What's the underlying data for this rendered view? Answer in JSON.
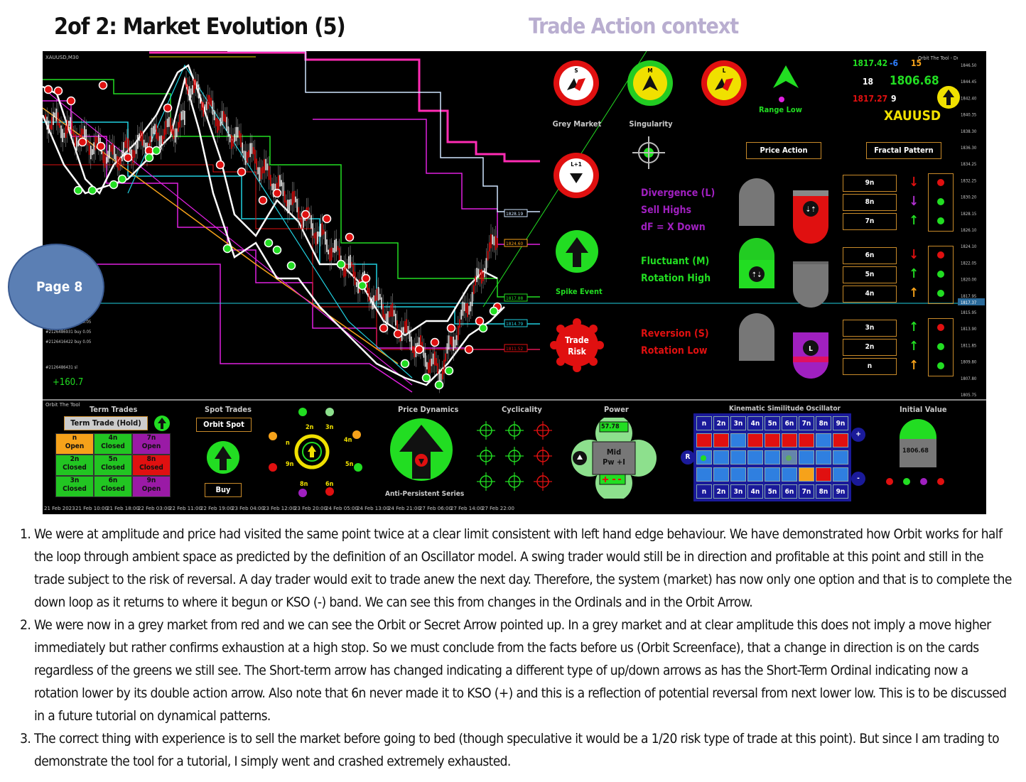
{
  "header": {
    "title": "2of 2: Market Evolution (5)",
    "context": "Trade Action context"
  },
  "page_badge": "Page 8",
  "chart": {
    "symbol_label": "XAUUSD,M30",
    "indicator_name": "Orbit The Tool - Dual",
    "price_ticks": [
      "1846.50",
      "1844.45",
      "1842.40",
      "1840.35",
      "1838.30",
      "1836.30",
      "1834.25",
      "1832.25",
      "1830.20",
      "1828.15",
      "1826.10",
      "1824.10",
      "1822.05",
      "1820.00",
      "1817.95",
      "1815.95",
      "1813.90",
      "1811.85",
      "1809.80",
      "1807.80",
      "1805.75"
    ],
    "current_price": "1817.37",
    "level_tags": [
      "1828.19",
      "1824.60",
      "1817.88",
      "1814.79",
      "1811.52"
    ],
    "orders": [
      "#2126599471 buy 0.05",
      "#2126486931 buy 0.05",
      "#2126416422 buy 0.05",
      "#2126486431 sl"
    ],
    "profit": "+160.7",
    "time_ticks": [
      "21 Feb 2023",
      "21 Feb 10:00",
      "21 Feb 18:00",
      "22 Feb 03:00",
      "22 Feb 11:00",
      "22 Feb 19:00",
      "23 Feb 04:00",
      "23 Feb 12:00",
      "23 Feb 20:00",
      "24 Feb 05:00",
      "24 Feb 13:00",
      "24 Feb 21:00",
      "27 Feb 06:00",
      "27 Feb 14:00",
      "27 Feb 22:00"
    ]
  },
  "context_panel": {
    "circles": [
      {
        "letter": "S",
        "label": "Grey Market"
      },
      {
        "letter": "M",
        "label": "Singularity"
      },
      {
        "letter": "L",
        "label": ""
      }
    ],
    "range_low": "Range Low",
    "quote": {
      "bid": "1817.42",
      "delta": "-6",
      "count": "15",
      "left_num": "18",
      "price": "1806.68",
      "low": "1817.27",
      "right_num": "9",
      "symbol": "XAUUSD"
    },
    "lplus1": "L+1",
    "spike_event": "Spike Event",
    "trade_risk": [
      "Trade",
      "Risk"
    ],
    "price_action_btn": "Price Action",
    "fractal_pattern_btn": "Fractal Pattern",
    "divergence": [
      "Divergence (L)",
      "Sell Highs",
      "dF = X Down"
    ],
    "fluctuant": [
      "Fluctuant (M)",
      "Rotation High"
    ],
    "reversion": [
      "Reversion (S)",
      "Rotation Low"
    ],
    "ordinals": [
      "9n",
      "8n",
      "7n",
      "6n",
      "5n",
      "4n",
      "3n",
      "2n",
      "n"
    ],
    "ordinal_arrows": [
      "down-red",
      "down-purple",
      "up-green",
      "down-red",
      "up-green",
      "up-orange",
      "up-green",
      "up-green",
      "up-orange"
    ],
    "ordinal_dots": [
      "red",
      "green",
      "green",
      "red",
      "green",
      "green",
      "red",
      "green",
      "green"
    ],
    "l_badge": "L"
  },
  "lower_panel": {
    "brand": "Orbit The Tool",
    "term_trades": {
      "title": "Term Trades",
      "button": "Term Trade (Hold)",
      "cells": [
        {
          "top": "n",
          "bottom": "Open",
          "color": "#f6a21a"
        },
        {
          "top": "4n",
          "bottom": "Closed",
          "color": "#22c522"
        },
        {
          "top": "7n",
          "bottom": "Open",
          "color": "#9a1aa6"
        },
        {
          "top": "2n",
          "bottom": "Closed",
          "color": "#22c522"
        },
        {
          "top": "5n",
          "bottom": "Closed",
          "color": "#22c522"
        },
        {
          "top": "8n",
          "bottom": "Closed",
          "color": "#e01010"
        },
        {
          "top": "3n",
          "bottom": "Closed",
          "color": "#22c522"
        },
        {
          "top": "6n",
          "bottom": "Closed",
          "color": "#22c522"
        },
        {
          "top": "9n",
          "bottom": "Open",
          "color": "#9a1aa6"
        }
      ]
    },
    "spot_trades": {
      "title": "Spot Trades",
      "button": "Orbit Spot",
      "buy": "Buy"
    },
    "ring_labels": [
      "2n",
      "3n",
      "4n",
      "5n",
      "6n",
      "8n",
      "9n",
      "n"
    ],
    "price_dynamics": {
      "title": "Price Dynamics",
      "caption": "Anti-Persistent Series"
    },
    "cyclicality": {
      "title": "Cyclicality"
    },
    "power": {
      "title": "Power",
      "value": "57.78",
      "line1": "Mid",
      "line2": "Pw +I"
    },
    "kso": {
      "title": "Kinematic Similitude Oscillator",
      "header": [
        "n",
        "2n",
        "3n",
        "4n",
        "5n",
        "6n",
        "7n",
        "8n",
        "9n"
      ],
      "rows": [
        [
          "#e01010",
          "#e01010",
          "#2f7fe0",
          "#e01010",
          "#e01010",
          "#e01010",
          "#e01010",
          "#2f7fe0",
          "#e01010"
        ],
        [
          "#2f7fe0",
          "#2f7fe0",
          "#2f7fe0",
          "#2f7fe0",
          "#2f7fe0",
          "#2f7fe0",
          "#2f7fe0",
          "#2f7fe0",
          "#2f7fe0"
        ],
        [
          "#2f7fe0",
          "#2f7fe0",
          "#2f7fe0",
          "#2f7fe0",
          "#2f7fe0",
          "#2f7fe0",
          "#f6a21a",
          "#e01010",
          "#2f7fe0"
        ]
      ],
      "plus": "+",
      "minus": "-",
      "r": "R"
    },
    "initial_value": {
      "title": "Initial Value",
      "value": "1806.68"
    }
  },
  "notes": [
    "We were at amplitude and price had visited the same point twice at a clear limit consistent with left hand edge behaviour. We have demonstrated how Orbit works for half the loop through ambient space as predicted by the definition of an Oscillator model. A swing trader would still be in direction and profitable at this point and still in the trade subject to the risk of reversal. A day trader would exit to trade anew the next day. Therefore, the system (market) has now only one option and that is to complete the down loop as it returns to where it begun or KSO (-) band. We can see this from changes in the Ordinals and in the Orbit Arrow.",
    "We were now in a grey market from red and we can see the Orbit or Secret Arrow pointed up. In a grey market and at clear amplitude this does not imply a move higher immediately but rather confirms exhaustion at a high stop. So we must conclude from the facts before us (Orbit Screenface), that a change in direction is on the cards regardless of the greens we still see. The Short-term arrow has changed indicating a different type of up/down arrows as has the Short-Term Ordinal indicating now a rotation lower by its double action arrow. Also note that 6n never made it to KSO (+) and this is a reflection of potential reversal from next lower low. This is to be discussed in a future tutorial on dynamical patterns.",
    "The correct thing with experience is to sell the market before going to bed (though speculative it would be a 1/20 risk type of trade at this point). But since I am trading to demonstrate the tool for a tutorial, I simply went and crashed extremely exhausted."
  ],
  "colors": {
    "screen_bg": "#000000",
    "green": "#22dd22",
    "red": "#e01010",
    "purple": "#a020c0",
    "orange": "#f6a21a",
    "yellow": "#f0e000"
  }
}
